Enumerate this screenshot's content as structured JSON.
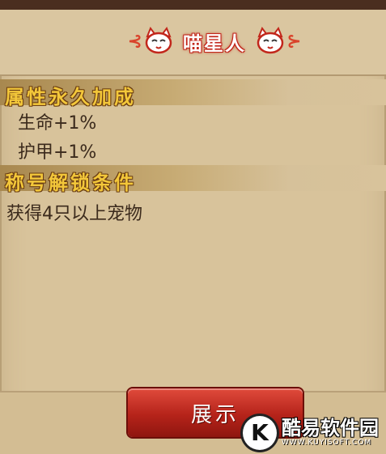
{
  "header": {
    "title": "喵星人",
    "left_swirl": "⊰",
    "right_swirl": "⊱"
  },
  "sections": [
    {
      "title": "属性永久加成",
      "lines": [
        "生命+1%",
        "护甲+1%"
      ]
    },
    {
      "title": "称号解锁条件",
      "lines": [
        "获得4只以上宠物"
      ]
    }
  ],
  "footer": {
    "show_button_label": "展示"
  },
  "watermark": {
    "logo_letter": "K",
    "name": "酷易软件园",
    "domain": "WWW.KUYISOFT.COM"
  },
  "colors": {
    "panel": "#d8c39b",
    "section_title": "#f3c73a",
    "button_red": "#b5231a",
    "title_outline": "#c2271b"
  },
  "icons": [
    "cat-face-icon-left",
    "cat-face-icon-right"
  ]
}
